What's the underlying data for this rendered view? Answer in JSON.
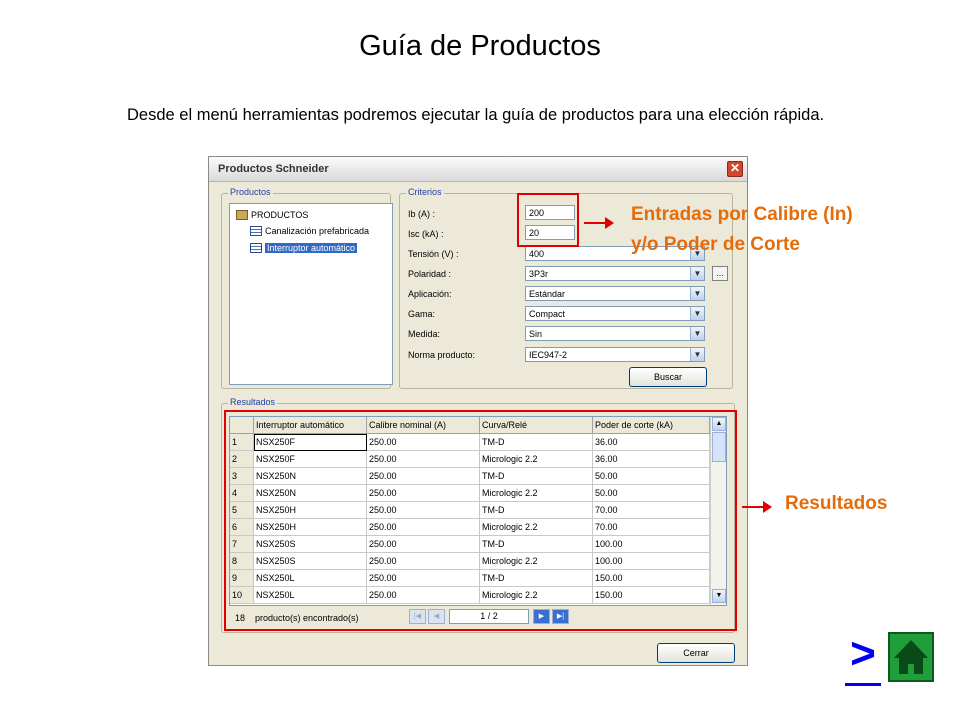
{
  "slide": {
    "title": "Guía de Productos",
    "intro": "Desde el menú herramientas podremos ejecutar la guía de productos para una elección rápida."
  },
  "dialog": {
    "title": "Productos Schneider",
    "close_label": "✕",
    "productos_group": "Productos",
    "tree": {
      "root": "PRODUCTOS",
      "items": [
        "Canalización prefabricada",
        "Interruptor automático"
      ]
    },
    "criterios_group": "Criterios",
    "criterios": [
      {
        "label": "Ib (A) :",
        "value": ""
      },
      {
        "label": "Isc (kA) :",
        "value": ""
      },
      {
        "label": "Tensión (V) :",
        "value": "400"
      },
      {
        "label": "Polaridad :",
        "value": "3P3r"
      },
      {
        "label": "Aplicación:",
        "value": "Estándar"
      },
      {
        "label": "Gama:",
        "value": "Compact"
      },
      {
        "label": "Medida:",
        "value": "Sin"
      },
      {
        "label": "Norma producto:",
        "value": "IEC947-2"
      }
    ],
    "ib_value": "200",
    "isc_value": "20",
    "dots_label": "...",
    "buscar_label": "Buscar",
    "resultados_group": "Resultados",
    "columns": [
      "",
      "Interruptor automático",
      "Calibre nominal (A)",
      "Curva/Relé",
      "Poder de corte (kA)"
    ],
    "rows": [
      [
        "1",
        "NSX250F",
        "250.00",
        "TM-D",
        "36.00"
      ],
      [
        "2",
        "NSX250F",
        "250.00",
        "Micrologic 2.2",
        "36.00"
      ],
      [
        "3",
        "NSX250N",
        "250.00",
        "TM-D",
        "50.00"
      ],
      [
        "4",
        "NSX250N",
        "250.00",
        "Micrologic 2.2",
        "50.00"
      ],
      [
        "5",
        "NSX250H",
        "250.00",
        "TM-D",
        "70.00"
      ],
      [
        "6",
        "NSX250H",
        "250.00",
        "Micrologic 2.2",
        "70.00"
      ],
      [
        "7",
        "NSX250S",
        "250.00",
        "TM-D",
        "100.00"
      ],
      [
        "8",
        "NSX250S",
        "250.00",
        "Micrologic 2.2",
        "100.00"
      ],
      [
        "9",
        "NSX250L",
        "250.00",
        "TM-D",
        "150.00"
      ],
      [
        "10",
        "NSX250L",
        "250.00",
        "Micrologic 2.2",
        "150.00"
      ]
    ],
    "found_count": "18",
    "found_text": "producto(s) encontrado(s)",
    "page_indicator": "1 / 2",
    "cerrar_label": "Cerrar"
  },
  "annotations": {
    "entradas_line1": "Entradas por Calibre (In)",
    "entradas_line2": "y/o Poder de Corte",
    "resultados": "Resultados",
    "color": "#e46c0a"
  },
  "nav": {
    "next_label": ">",
    "home_icon": "home-icon"
  }
}
